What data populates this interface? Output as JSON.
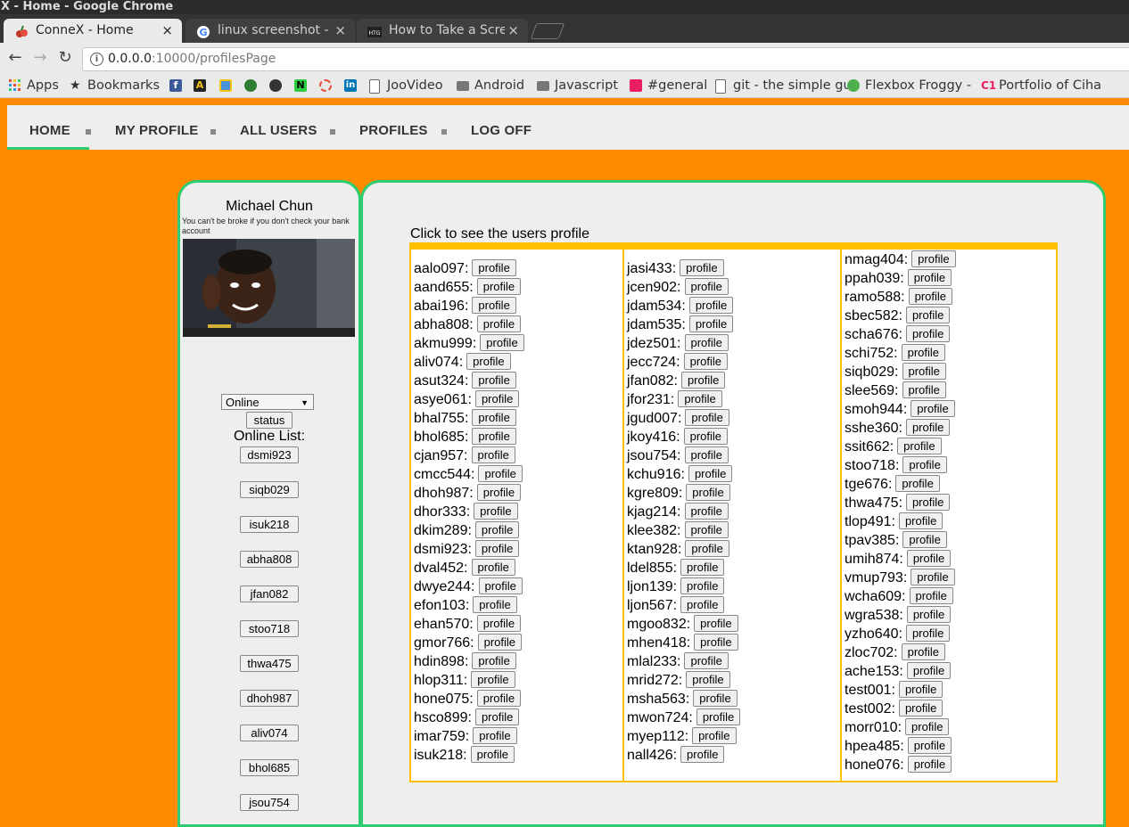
{
  "window": {
    "title": "X - Home - Google Chrome"
  },
  "tabs": [
    {
      "title": "ConneX - Home",
      "active": true,
      "close": "×"
    },
    {
      "title": "linux screenshot - G",
      "active": false,
      "close": "×"
    },
    {
      "title": "How to Take a Scree",
      "active": false,
      "close": "×"
    }
  ],
  "address": {
    "host": "0.0.0.0",
    "rest": ":10000/profilesPage"
  },
  "bookmarks": [
    "Apps",
    "Bookmarks",
    "JooVideo",
    "Android",
    "Javascript",
    "#general",
    "git - the simple gu",
    "Flexbox Froggy -",
    "Portfolio of Ciha"
  ],
  "nav": {
    "items": [
      "HOME",
      "MY PROFILE",
      "ALL USERS",
      "PROFILES",
      "LOG OFF"
    ],
    "active_index": 0
  },
  "sidebar": {
    "name": "Michael Chun",
    "tagline": "You can't be broke if you don't check your bank account",
    "status_value": "Online",
    "status_button": "status",
    "online_label": "Online List:",
    "online_users": [
      "dsmi923",
      "siqb029",
      "isuk218",
      "abha808",
      "jfan082",
      "stoo718",
      "thwa475",
      "dhoh987",
      "aliv074",
      "bhol685",
      "jsou754"
    ]
  },
  "main": {
    "caption": "Click to see the users profile",
    "button_label": "profile",
    "columns": [
      [
        "aalo097",
        "aand655",
        "abai196",
        "abha808",
        "akmu999",
        "aliv074",
        "asut324",
        "asye061",
        "bhal755",
        "bhol685",
        "cjan957",
        "cmcc544",
        "dhoh987",
        "dhor333",
        "dkim289",
        "dsmi923",
        "dval452",
        "dwye244",
        "efon103",
        "ehan570",
        "gmor766",
        "hdin898",
        "hlop311",
        "hone075",
        "hsco899",
        "imar759",
        "isuk218"
      ],
      [
        "jasi433",
        "jcen902",
        "jdam534",
        "jdam535",
        "jdez501",
        "jecc724",
        "jfan082",
        "jfor231",
        "jgud007",
        "jkoy416",
        "jsou754",
        "kchu916",
        "kgre809",
        "kjag214",
        "klee382",
        "ktan928",
        "ldel855",
        "ljon139",
        "ljon567",
        "mgoo832",
        "mhen418",
        "mlal233",
        "mrid272",
        "msha563",
        "mwon724",
        "myep112",
        "nall426"
      ],
      [
        "nmag404",
        "ppah039",
        "ramo588",
        "sbec582",
        "scha676",
        "schi752",
        "siqb029",
        "slee569",
        "smoh944",
        "sshe360",
        "ssit662",
        "stoo718",
        "tge676",
        "thwa475",
        "tlop491",
        "tpav385",
        "umih874",
        "vmup793",
        "wcha609",
        "wgra538",
        "yzho640",
        "zloc702",
        "ache153",
        "test001",
        "test002",
        "morr010",
        "hpea485",
        "hone076"
      ]
    ]
  }
}
